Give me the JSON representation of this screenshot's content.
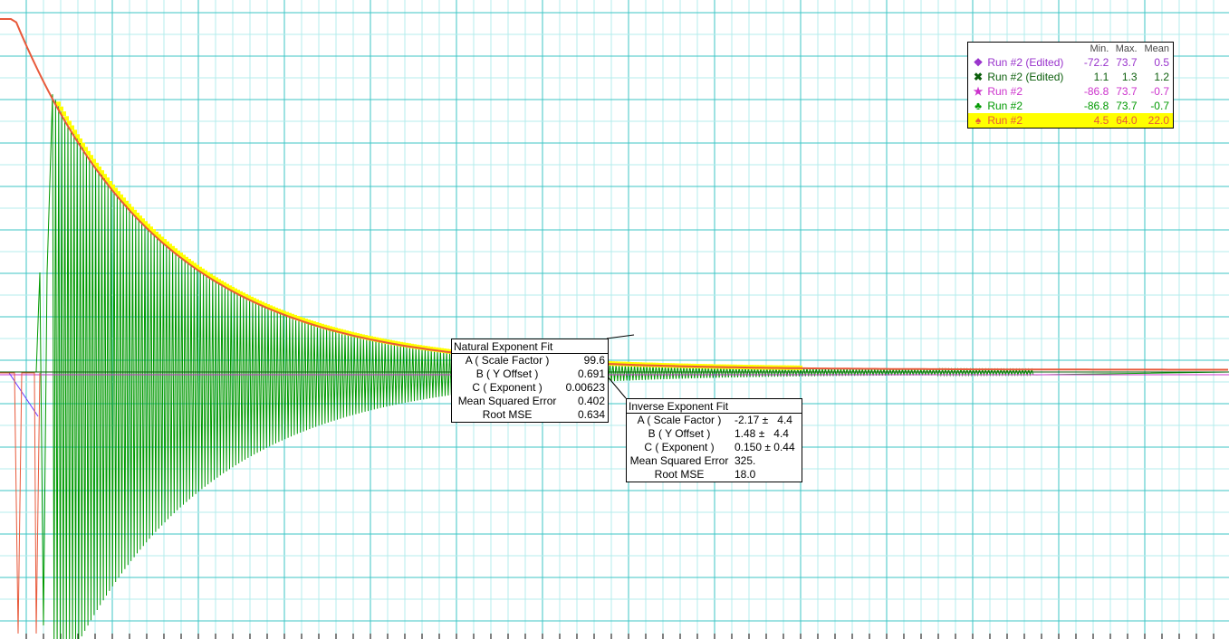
{
  "chart_data": {
    "type": "line",
    "grid": true,
    "series": [
      {
        "name": "Run #2",
        "kind": "oscillation",
        "color": "#009900",
        "amplitude_fit": {
          "A": 99.6,
          "B": 0.691,
          "C": 0.00623
        }
      },
      {
        "name": "Run #2",
        "kind": "envelope-markers",
        "color": "#ffff00"
      },
      {
        "name": "Run #2 (Edited)",
        "kind": "fit-curve",
        "color": "#e8593a"
      },
      {
        "name": "Run #2 (Edited)",
        "kind": "baseline",
        "color": "#0b5e0b"
      },
      {
        "name": "Run #2",
        "kind": "baseline",
        "color": "#cc33cc"
      }
    ]
  },
  "legend": {
    "headers": [
      "Min.",
      "Max.",
      "Mean"
    ],
    "rows": [
      {
        "symbol": "❖",
        "color": "#9933cc",
        "name": "Run #2 (Edited)",
        "min": "-72.2",
        "max": "73.7",
        "mean": "0.5",
        "highlight": false
      },
      {
        "symbol": "✖",
        "color": "#0b5e0b",
        "name": "Run #2 (Edited)",
        "min": "1.1",
        "max": "1.3",
        "mean": "1.2",
        "highlight": false
      },
      {
        "symbol": "★",
        "color": "#cc33cc",
        "name": "Run #2",
        "min": "-86.8",
        "max": "73.7",
        "mean": "-0.7",
        "highlight": false
      },
      {
        "symbol": "♣",
        "color": "#009900",
        "name": "Run #2",
        "min": "-86.8",
        "max": "73.7",
        "mean": "-0.7",
        "highlight": false
      },
      {
        "symbol": "♠",
        "color": "#e8593a",
        "name": "Run #2",
        "min": "4.5",
        "max": "64.0",
        "mean": "22.0",
        "highlight": true
      }
    ]
  },
  "natural_fit": {
    "title": "Natural Exponent Fit",
    "rows": [
      {
        "label": "A ( Scale Factor )",
        "value": "99.6"
      },
      {
        "label": "B ( Y Offset )",
        "value": "0.691"
      },
      {
        "label": "C ( Exponent )",
        "value": "0.00623"
      },
      {
        "label": "Mean Squared Error",
        "value": "0.402"
      },
      {
        "label": "Root MSE",
        "value": "0.634"
      }
    ]
  },
  "inverse_fit": {
    "title": "Inverse Exponent Fit",
    "rows": [
      {
        "label": "A ( Scale Factor )",
        "value": "-2.17 ±   4.4"
      },
      {
        "label": "B ( Y Offset )",
        "value": "1.48 ±   4.4"
      },
      {
        "label": "C ( Exponent )",
        "value": "0.150 ± 0.44"
      },
      {
        "label": "Mean Squared Error",
        "value": "325."
      },
      {
        "label": "Root MSE",
        "value": "18.0"
      }
    ]
  }
}
